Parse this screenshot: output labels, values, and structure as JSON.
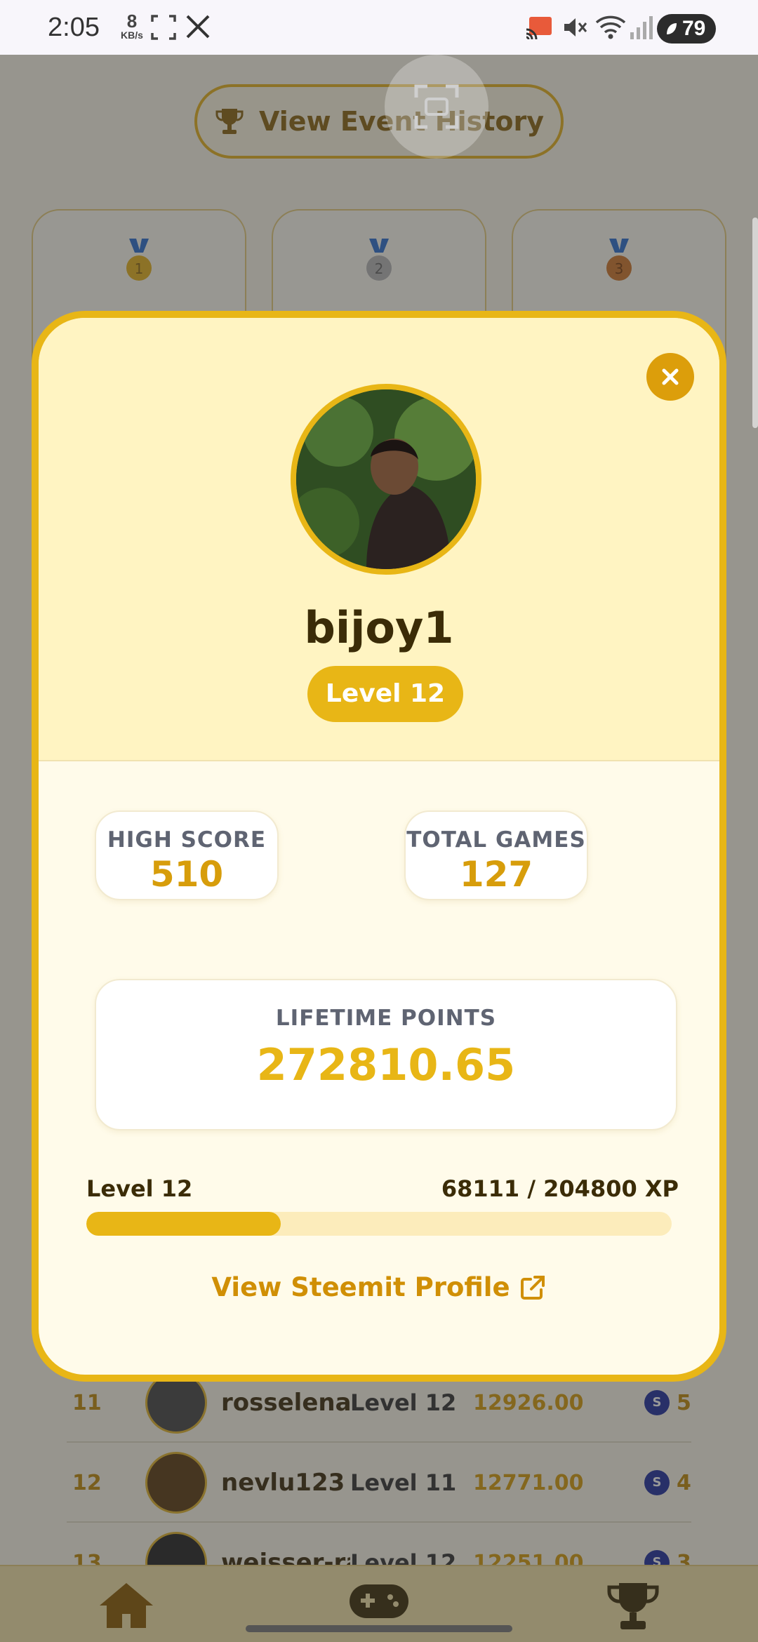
{
  "status_bar": {
    "time": "2:05",
    "net_speed": "8",
    "net_unit": "KB/s",
    "battery": "79",
    "icons": [
      "screenshot-icon",
      "x-logo-icon",
      "cast-icon",
      "mute-icon",
      "wifi-icon",
      "signal-icon",
      "battery-saver-icon"
    ]
  },
  "background": {
    "event_history_label": "View Event History",
    "podium_medals": [
      "1",
      "2",
      "3"
    ],
    "leaderboard": [
      {
        "rank": "11",
        "name": "rosselena",
        "level": "Level 12",
        "points": "12926.00",
        "games": "5"
      },
      {
        "rank": "12",
        "name": "nevlu123",
        "level": "Level 11",
        "points": "12771.00",
        "games": "4"
      },
      {
        "rank": "13",
        "name": "weisser-ra",
        "level": "Level 12",
        "points": "12251.00",
        "games": "3"
      }
    ],
    "nav": [
      "home-icon",
      "gamepad-icon",
      "trophy-icon"
    ]
  },
  "profile": {
    "username": "bijoy1",
    "level_badge": "Level 12",
    "high_score_label": "HIGH SCORE",
    "high_score": "510",
    "total_games_label": "TOTAL GAMES",
    "total_games": "127",
    "lifetime_points_label": "LIFETIME POINTS",
    "lifetime_points": "272810.65",
    "xp_level_label": "Level 12",
    "xp_text": "68111 / 204800 XP",
    "xp_current": 68111,
    "xp_max": 204800,
    "steemit_link": "View Steemit Profile"
  },
  "colors": {
    "accent": "#e8b616",
    "value_gold": "#d79d0b",
    "dark_text": "#3b2c07"
  }
}
